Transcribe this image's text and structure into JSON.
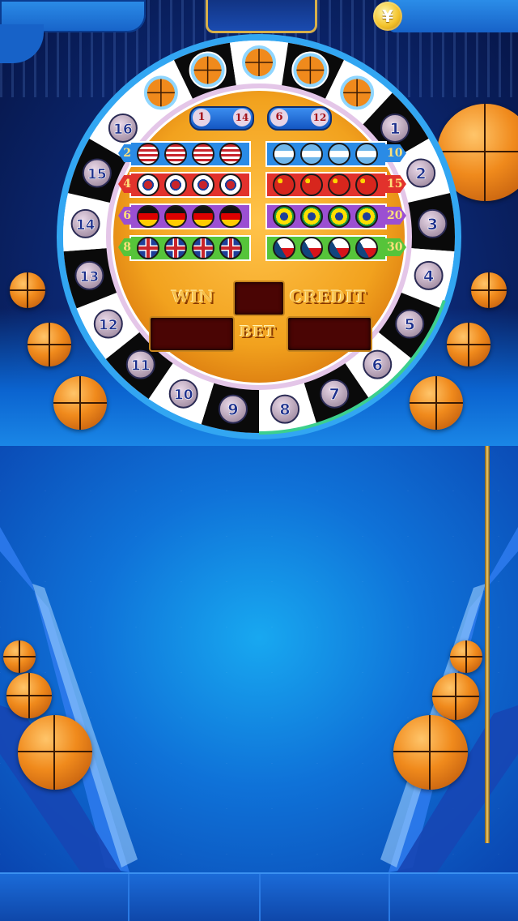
{
  "hud": {
    "coin_symbol": "¥"
  },
  "wheel": {
    "numbers": [
      "1",
      "2",
      "3",
      "4",
      "5",
      "6",
      "7",
      "8",
      "9",
      "10",
      "11",
      "12",
      "13",
      "14",
      "15",
      "16"
    ],
    "ball_slots": 5
  },
  "bonus": {
    "left": {
      "a": "1",
      "b": "14"
    },
    "right": {
      "a": "6",
      "b": "12"
    }
  },
  "bet_rows": [
    {
      "left_multiplier": "2",
      "right_multiplier": "10",
      "left_flag": "usa-flag-icon",
      "right_flag": "argentina-flag-icon",
      "left_color": "#2a8be6",
      "right_color": "#2a8be6"
    },
    {
      "left_multiplier": "4",
      "right_multiplier": "15",
      "left_flag": "korea-flag-icon",
      "right_flag": "china-flag-icon",
      "left_color": "#e2322c",
      "right_color": "#e2322c"
    },
    {
      "left_multiplier": "6",
      "right_multiplier": "20",
      "left_flag": "germany-flag-icon",
      "right_flag": "brazil-flag-icon",
      "left_color": "#9b4fd2",
      "right_color": "#9b4fd2"
    },
    {
      "left_multiplier": "8",
      "right_multiplier": "30",
      "left_flag": "uk-flag-icon",
      "right_flag": "czech-flag-icon",
      "left_color": "#56c43a",
      "right_color": "#56c43a"
    }
  ],
  "panel": {
    "win_label": "WIN",
    "credit_label": "CREDIT",
    "bet_label": "BET"
  },
  "colors": {
    "wheel_center": "#f2a21e",
    "display_bg": "#4a0504",
    "accent_gold": "#f8c04c"
  }
}
